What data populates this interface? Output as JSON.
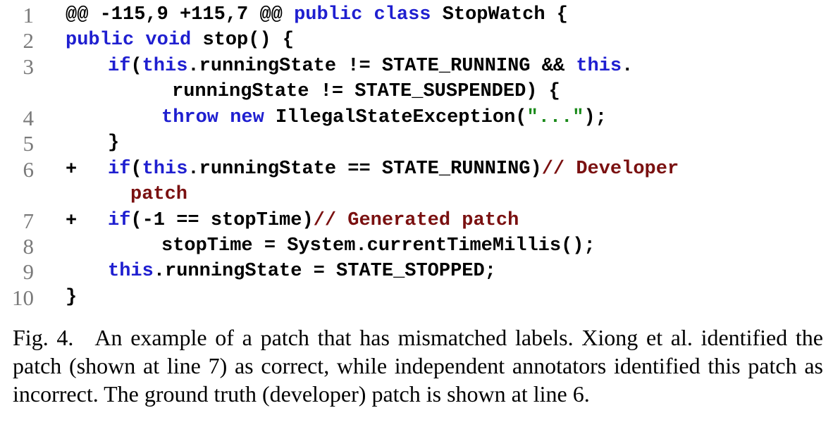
{
  "listing": {
    "line_numbers": [
      "1",
      "2",
      "3",
      "4",
      "5",
      "6",
      "7",
      "8",
      "9",
      "10"
    ],
    "diff_markers": [
      "+",
      "+"
    ],
    "l1": {
      "hunk": "@@ -115,9 +115,7 @@",
      "kw1": "public",
      "kw2": "class",
      "rest": "StopWatch {"
    },
    "l2": {
      "kw1": "public",
      "kw2": "void",
      "rest": "stop() {"
    },
    "l3": {
      "kw1": "if",
      "p1": "(",
      "kw2": "this",
      "p2": ".runningState != STATE_RUNNING && ",
      "kw3": "this",
      "p3": "."
    },
    "l3b": {
      "text": "runningState != STATE_SUSPENDED) {"
    },
    "l4": {
      "kw1": "throw",
      "kw2": "new",
      "p1": "IllegalStateException(",
      "str": "\"...\"",
      "p2": ");"
    },
    "l5": {
      "text": "}"
    },
    "l6": {
      "kw1": "if",
      "p1": "(",
      "kw2": "this",
      "p2": ".runningState == STATE_RUNNING)",
      "comment": "// Developer"
    },
    "l6b": {
      "comment": "patch"
    },
    "l7": {
      "kw1": "if",
      "p1": "(-1 == stopTime)",
      "comment": "// Generated patch"
    },
    "l8": {
      "text": "stopTime = System.currentTimeMillis();"
    },
    "l9": {
      "kw1": "this",
      "p1": ".runningState = STATE_STOPPED;"
    },
    "l10": {
      "text": "}"
    }
  },
  "caption": {
    "label": "Fig. 4.",
    "text": "An example of a patch that has mismatched labels. Xiong et al. identified the patch (shown at line 7) as correct, while independent annotators identified this patch as incorrect. The ground truth (developer) patch is shown at line 6."
  }
}
